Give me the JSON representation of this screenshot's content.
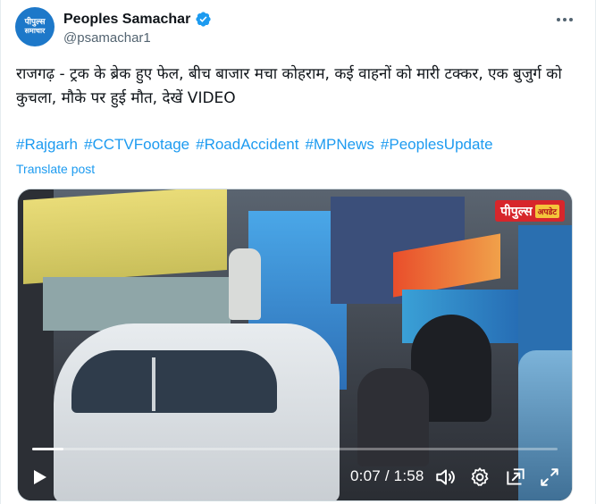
{
  "account": {
    "display_name": "Peoples Samachar",
    "handle": "@psamachar1",
    "avatar_line1": "पीपुल्स",
    "avatar_line2": "समाचार"
  },
  "post": {
    "text": "राजगढ़ - ट्रक के ब्रेक हुए फेल, बीच बाजार मचा कोहराम, कई वाहनों को मारी टक्कर, एक बुजुर्ग को कुचला, मौके पर हुई मौत, देखें VIDEO",
    "hashtags": [
      "#Rajgarh",
      "#CCTVFootage",
      "#RoadAccident",
      "#MPNews",
      "#PeoplesUpdate"
    ],
    "translate_label": "Translate post"
  },
  "video": {
    "brand_main": "पीपुल्स",
    "brand_tag": "अपडेट",
    "current_time": "0:07",
    "separator": " / ",
    "duration": "1:58",
    "progress_fraction": 0.06
  },
  "colors": {
    "accent": "#1d9bf0",
    "avatar_bg": "#1d78c9",
    "brand_red": "#d7262b",
    "brand_yellow": "#f4c53b"
  },
  "icons": {
    "verified": "verified-badge-icon",
    "more": "more-options-icon",
    "play": "play-icon",
    "volume": "volume-icon",
    "settings": "settings-gear-icon",
    "pip": "picture-in-picture-icon",
    "fullscreen": "fullscreen-icon"
  }
}
